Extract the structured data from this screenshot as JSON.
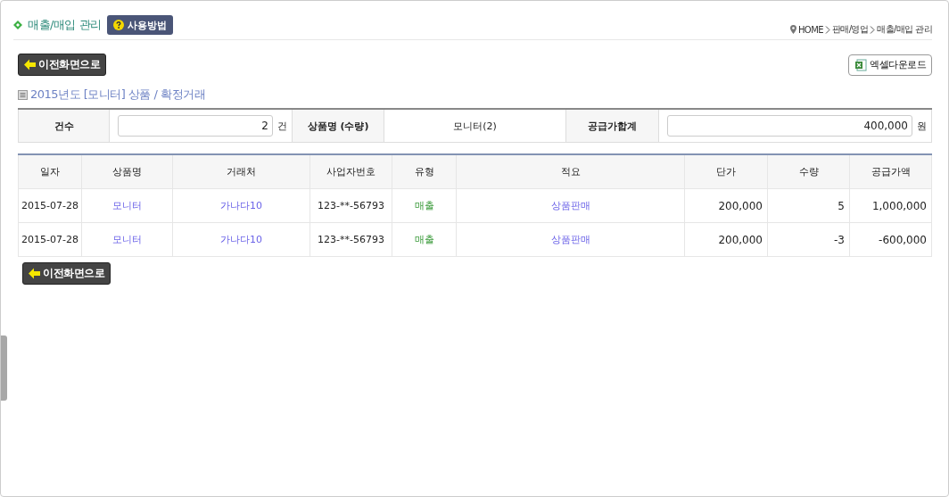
{
  "header": {
    "title": "매출/매입 관리",
    "help_button": "사용방법",
    "breadcrumb": [
      "HOME",
      "판매/영업",
      "매출/매입 관리"
    ]
  },
  "back_button": "이전화면으로",
  "excel_button": "엑셀다운로드",
  "section_title": "2015년도 [모니터] 상품 / 확정거래",
  "summary": {
    "count_label": "건수",
    "count_value": "2",
    "count_unit": "건",
    "product_label": "상품명 (수량)",
    "product_value": "모니터(2)",
    "total_label": "공급가합계",
    "total_value": "400,000",
    "total_unit": "원"
  },
  "table": {
    "columns": [
      {
        "label": "일자",
        "kind": "text"
      },
      {
        "label": "상품명",
        "kind": "link"
      },
      {
        "label": "거래처",
        "kind": "link"
      },
      {
        "label": "사업자번호",
        "kind": "text"
      },
      {
        "label": "유형",
        "kind": "type"
      },
      {
        "label": "적요",
        "kind": "link"
      },
      {
        "label": "단가",
        "kind": "number"
      },
      {
        "label": "수량",
        "kind": "number"
      },
      {
        "label": "공급가액",
        "kind": "number"
      }
    ],
    "rows": [
      [
        "2015-07-28",
        "모니터",
        "가나다10",
        "123-**-56793",
        "매출",
        "상품판매",
        "200,000",
        "5",
        "1,000,000"
      ],
      [
        "2015-07-28",
        "모니터",
        "가나다10",
        "123-**-56793",
        "매출",
        "상품판매",
        "200,000",
        "-3",
        "-600,000"
      ]
    ]
  },
  "back_button_bottom": "이전화면으로"
}
